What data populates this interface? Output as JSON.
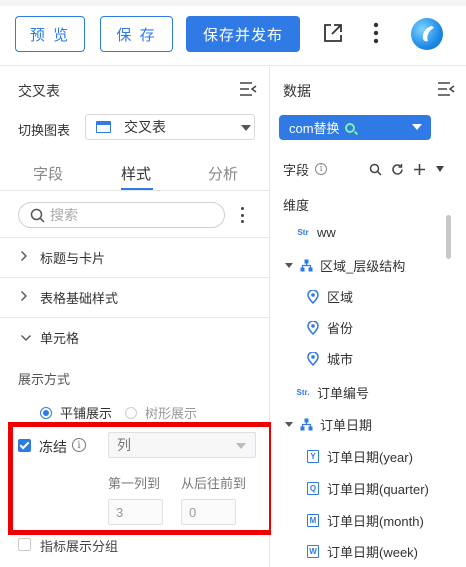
{
  "toolbar": {
    "preview_label": "预 览",
    "save_label": "保 存",
    "save_publish_label": "保存并发布"
  },
  "left_panel": {
    "title": "交叉表",
    "switch_chart_label": "切换图表",
    "chart_type_value": "交叉表",
    "tabs": [
      {
        "label": "字段"
      },
      {
        "label": "样式"
      },
      {
        "label": "分析"
      }
    ],
    "search_placeholder": "搜索",
    "sections": [
      {
        "label": "标题与卡片"
      },
      {
        "label": "表格基础样式"
      },
      {
        "label": "单元格"
      }
    ],
    "display_mode_label": "展示方式",
    "display_options": [
      {
        "label": "平铺展示",
        "selected": true
      },
      {
        "label": "树形展示",
        "selected": false
      }
    ],
    "freeze": {
      "label": "冻结",
      "checked": true,
      "mode_value": "列",
      "first_col_label": "第一列到",
      "from_back_label": "从后往前到",
      "first_col_value": "3",
      "from_back_value": "0"
    },
    "metric_group_label": "指标展示分组"
  },
  "right_panel": {
    "title": "数据",
    "dataset_value": "com替换",
    "field_label": "字段",
    "dimension_heading": "维度",
    "tree_items": [
      {
        "type_tag": "Str",
        "label": "ww"
      },
      {
        "label": "区域_层级结构"
      },
      {
        "label": "区域"
      },
      {
        "label": "省份"
      },
      {
        "label": "城市"
      },
      {
        "type_tag": "Str.",
        "label": "订单编号"
      },
      {
        "label": "订单日期"
      },
      {
        "tag": "Y",
        "label": "订单日期(year)"
      },
      {
        "tag": "Q",
        "label": "订单日期(quarter)"
      },
      {
        "tag": "M",
        "label": "订单日期(month)"
      },
      {
        "tag": "W",
        "label": "订单日期(week)"
      }
    ]
  },
  "colors": {
    "accent": "#2f7ae5",
    "highlight_box": "#ee0000"
  }
}
